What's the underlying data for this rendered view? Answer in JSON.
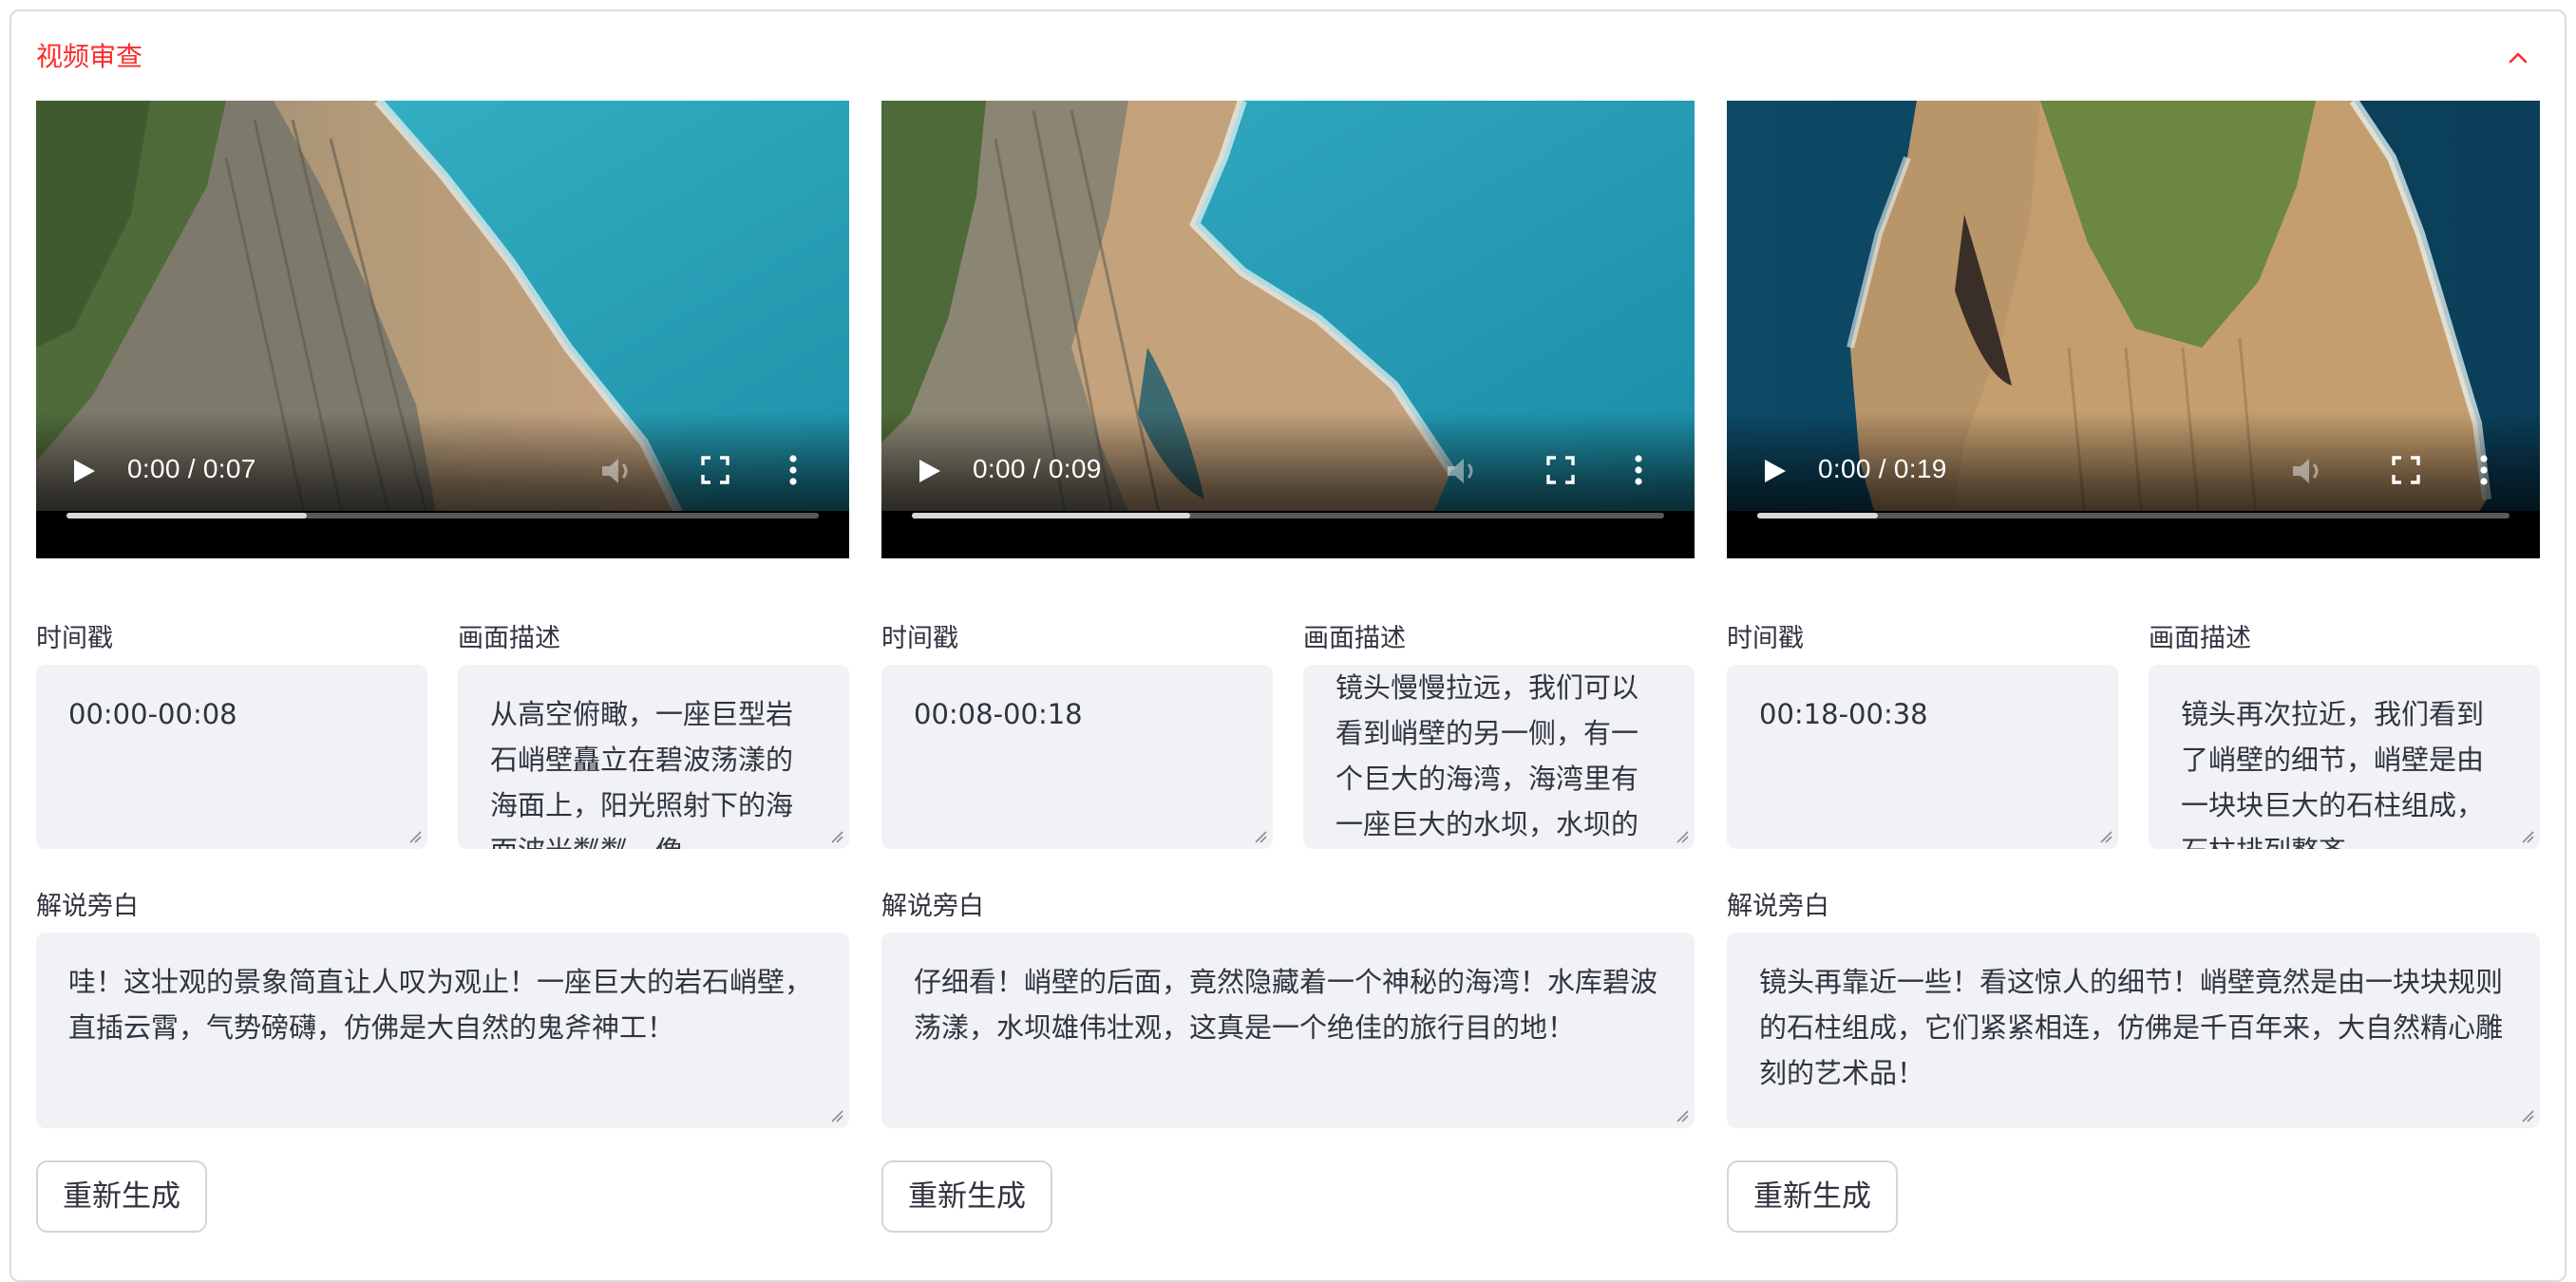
{
  "panel": {
    "title": "视频审查",
    "title_color": "#ff2b2b",
    "collapse_icon": "chevron-up-icon"
  },
  "labels": {
    "timestamp": "时间戳",
    "description": "画面描述",
    "narration": "解说旁白",
    "regenerate": "重新生成"
  },
  "clips": [
    {
      "video_time": "0:00 / 0:07",
      "progress": 0.32,
      "timestamp": "00:00-00:08",
      "description": "从高空俯瞰，一座巨型岩石峭壁矗立在碧波荡漾的海面上，阳光照射下的海面波光粼粼，像",
      "narration": "哇！这壮观的景象简直让人叹为观止！一座巨大的岩石峭壁，直插云霄，气势磅礴，仿佛是大自然的鬼斧神工！"
    },
    {
      "video_time": "0:00 / 0:09",
      "progress": 0.37,
      "timestamp": "00:08-00:18",
      "description": "镜头慢慢拉远，我们可以看到峭壁的另一侧，有一个巨大的海湾，海湾里有一座巨大的水坝，水坝的后面是一片",
      "narration": "仔细看！峭壁的后面，竟然隐藏着一个神秘的海湾！水库碧波荡漾，水坝雄伟壮观，这真是一个绝佳的旅行目的地！"
    },
    {
      "video_time": "0:00 / 0:19",
      "progress": 0.16,
      "timestamp": "00:18-00:38",
      "description": "镜头再次拉近，我们看到了峭壁的细节，峭壁是由一块块巨大的石柱组成，石柱排列整齐",
      "narration": "镜头再靠近一些！看这惊人的细节！峭壁竟然是由一块块规则的石柱组成，它们紧紧相连，仿佛是千百年来，大自然精心雕刻的艺术品！"
    }
  ]
}
